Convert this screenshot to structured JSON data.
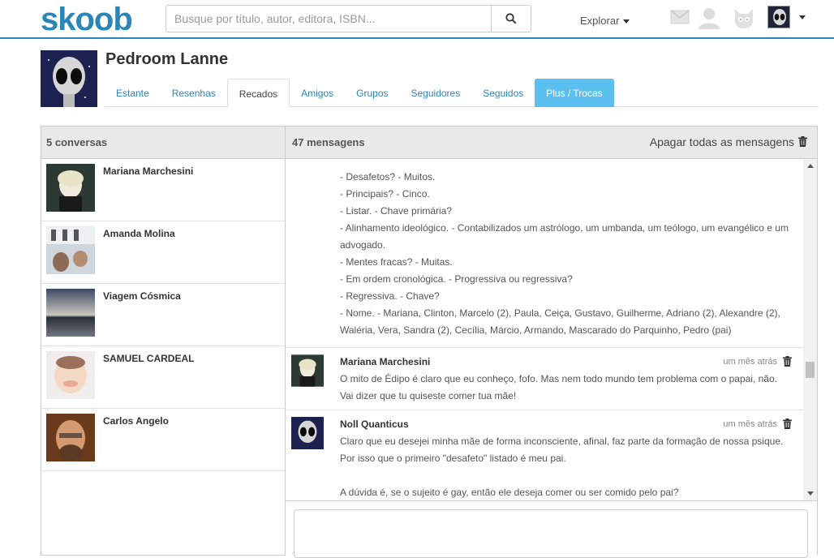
{
  "app": {
    "logo": "skoob"
  },
  "search": {
    "placeholder": "Busque por título, autor, editora, ISBN..."
  },
  "nav": {
    "explore_label": "Explorar"
  },
  "profile": {
    "name": "Pedroom Lanne"
  },
  "tabs": [
    {
      "label": "Estante"
    },
    {
      "label": "Resenhas"
    },
    {
      "label": "Recados"
    },
    {
      "label": "Amigos"
    },
    {
      "label": "Grupos"
    },
    {
      "label": "Seguidores"
    },
    {
      "label": "Seguidos"
    },
    {
      "label": "Plus / Trocas"
    }
  ],
  "conversations": {
    "header": "5 conversas",
    "items": [
      {
        "name": "Mariana Marchesini"
      },
      {
        "name": "Amanda Molina"
      },
      {
        "name": "Viagem Cósmica"
      },
      {
        "name": "SAMUEL CARDEAL"
      },
      {
        "name": "Carlos Angelo"
      }
    ]
  },
  "messages": {
    "header": "47 mensagens",
    "delete_all": "Apagar todas as mensagens",
    "first_lines": [
      "- Desafetos? - Muitos.",
      "- Principais? - Cinco.",
      "- Listar. - Chave primária?",
      "- Alinhamento ideológico. - Contabilizados um astrólogo, um umbanda, um teólogo, um evangélico e um advogado.",
      "- Mentes fracas? - Muitas.",
      "- Em ordem cronológica. - Progressiva ou regressiva?",
      "- Regressiva. - Chave?",
      "- Nome. - Mariana, Clinton, Marcelo (2), Paula, Ceiça, Gustavo, Guilherme, Adriano (2), Alexandre (2), Waléria, Vera, Sandra (2), Cecília, Márcio, Armando, Mascarado do Parquinho, Pedro (pai)"
    ],
    "items": [
      {
        "author": "Mariana Marchesini",
        "when": "um mês atrás",
        "body": "O mito de Édipo é claro que eu conheço, fofo. Mas nem todo mundo tem problema com o papai, não. Vai dizer que tu quiseste comer tua mãe!"
      },
      {
        "author": "Noll Quanticus",
        "when": "um mês atrás",
        "body": "Claro que eu desejei minha mãe de forma inconsciente, afinal, faz parte da formação de nossa psique. Por isso que o primeiro \"desafeto\" listado é meu pai.",
        "body2": "A dúvida é, se o sujeito é gay, então ele deseja comer ou ser comido pelo pai?"
      }
    ]
  },
  "colors": {
    "brand": "#2a86b7",
    "plus_tab": "#5bc0f0"
  },
  "icons": [
    "search-icon",
    "mail-icon",
    "user-icon",
    "cat-icon",
    "trash-icon",
    "caret-down-icon"
  ]
}
